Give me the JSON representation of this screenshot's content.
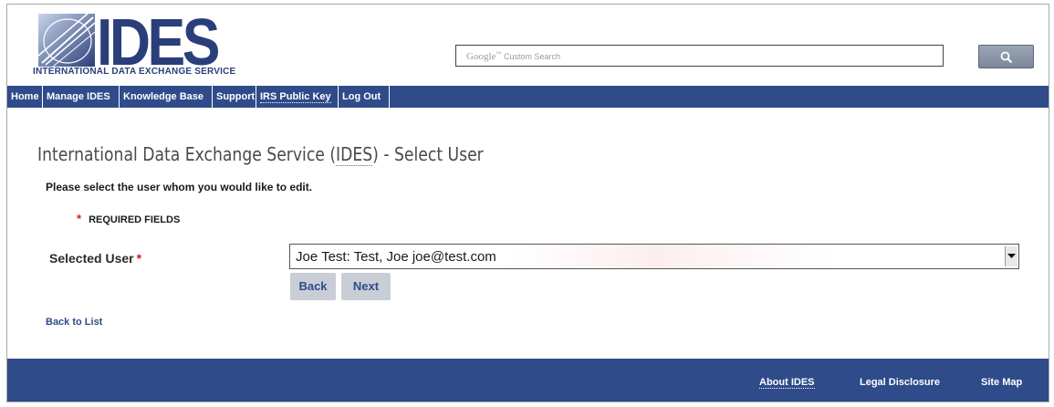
{
  "header": {
    "logo_text": "IDES",
    "logo_subtitle": "INTERNATIONAL DATA EXCHANGE SERVICE",
    "search": {
      "brand": "Google",
      "brand_mark": "™",
      "placeholder": "Custom Search",
      "button_icon": "search-icon"
    }
  },
  "nav": {
    "items": [
      {
        "label": "Home"
      },
      {
        "label": "Manage IDES"
      },
      {
        "label": "Knowledge Base"
      },
      {
        "label": "Support"
      },
      {
        "label": "IRS Public Key"
      },
      {
        "label": "Log Out"
      }
    ]
  },
  "main": {
    "title_prefix": "International Data Exchange Service (",
    "title_abbr": "IDES",
    "title_suffix": ") - Select User",
    "instruction": "Please select the user whom you would like to edit.",
    "required_star": "*",
    "required_note": "REQUIRED FIELDS",
    "selected_user_label": "Selected User",
    "selected_user_value": "Joe Test: Test, Joe joe@test.com",
    "back_label": "Back",
    "next_label": "Next",
    "back_to_list": "Back to List"
  },
  "footer": {
    "links": [
      {
        "label": "About IDES"
      },
      {
        "label": "Legal Disclosure"
      },
      {
        "label": "Site Map"
      }
    ]
  },
  "colors": {
    "nav_bg": "#2f4b8a",
    "required_star": "#d41b1b",
    "button_bg": "#c8cdd6",
    "logo_blue": "#2a3f7a"
  }
}
